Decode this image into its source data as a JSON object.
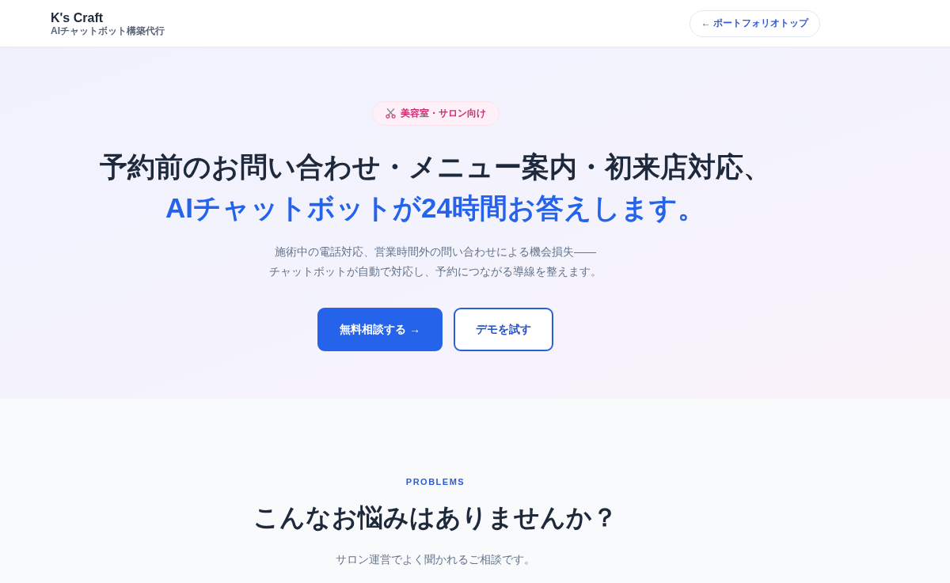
{
  "header": {
    "brand": "K's Craft",
    "tagline": "AIチャットボット構築代行",
    "nav_link": "← ポートフォリオトップ"
  },
  "hero": {
    "badge": "美容室・サロン向け",
    "headline": "予約前のお問い合わせ・メニュー案内・初来店対応、",
    "headline_highlight": "AIチャットボットが24時間お答えします。",
    "description_lines": [
      "施術中の電話対応、営業時間外の問い合わせによる機会損失——",
      "チャットボットが自動で対応し、予約につながる導線を整えます。"
    ],
    "buttons": [
      {
        "kind": "primary",
        "label": "無料相談する →"
      },
      {
        "kind": "outline",
        "label": "デモを試す"
      }
    ]
  },
  "problems": {
    "eyebrow": "PROBLEMS",
    "title": "こんなお悩みはありませんか？",
    "subtitle": "サロン運営でよく聞かれるご相談です。"
  }
}
